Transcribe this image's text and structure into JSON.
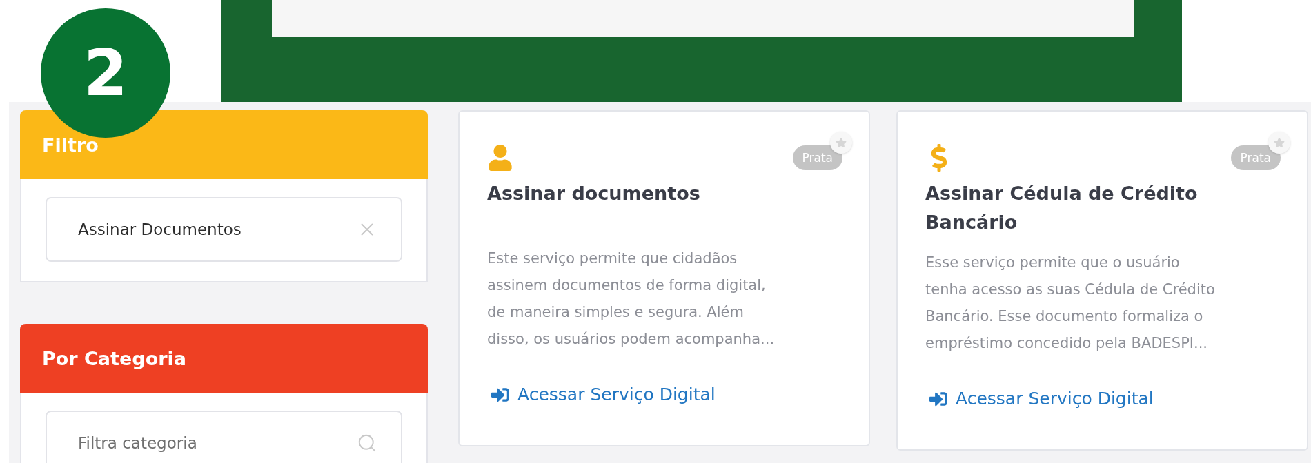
{
  "step_badge": "2",
  "filter_panel": {
    "title": "Filtro",
    "search": {
      "value": "Assinar Documentos"
    }
  },
  "category_panel": {
    "title": "Por Categoria",
    "search": {
      "placeholder": "Filtra categoria"
    }
  },
  "services": [
    {
      "kind": "person",
      "title": "Assinar documentos",
      "badge": "Prata",
      "favorite": false,
      "description_lines": [
        "Este serviço permite que cidadãos",
        "assinem documentos de forma digital,",
        "de maneira simples e segura. Além",
        "disso, os usuários podem acompanha..."
      ],
      "link": "Acessar Serviço Digital"
    },
    {
      "kind": "dollar",
      "title": "Assinar Cédula de Crédito Bancário",
      "badge": "Prata",
      "favorite": false,
      "description_lines": [
        "Esse serviço permite que o usuário",
        "tenha acesso as suas Cédula de Crédito",
        "Bancário. Esse documento formaliza o",
        "empréstimo concedido pela BADESPI..."
      ],
      "link": "Acessar Serviço Digital"
    }
  ]
}
